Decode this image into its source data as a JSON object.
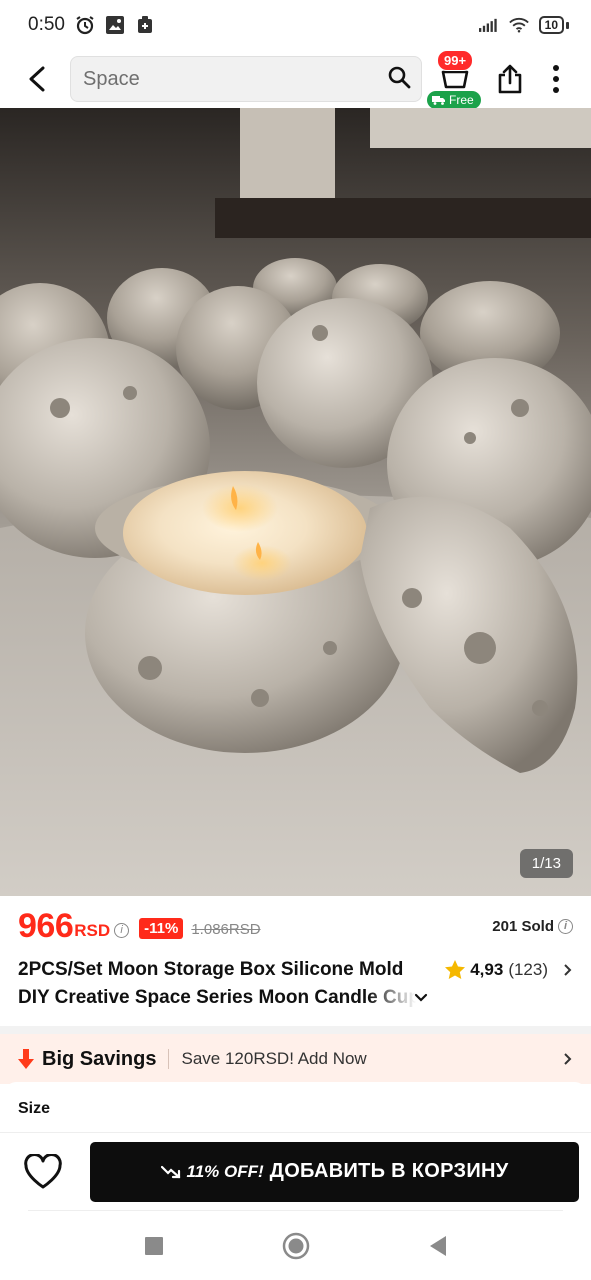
{
  "status_bar": {
    "time": "0:50",
    "battery": "10"
  },
  "search": {
    "placeholder": "Space"
  },
  "cart": {
    "badge": "99+",
    "free_label": "Free"
  },
  "gallery": {
    "counter": "1/13"
  },
  "price": {
    "amount": "966",
    "currency": "RSD",
    "discount": "-11%",
    "original": "1.086RSD",
    "sold": "201 Sold"
  },
  "product": {
    "title_line1": "2PCS/Set Moon Storage Box Silicone Mold",
    "title_line2": "DIY Creative Space Series Moon Candle Cup",
    "rating": "4,93",
    "rating_count": "(123)"
  },
  "savings": {
    "title": "Big Savings",
    "text": "Save 120RSD! Add Now"
  },
  "size": {
    "label": "Size"
  },
  "action": {
    "discount": "11% OFF!",
    "add_to_cart": "ДОБАВИТЬ В КОРЗИНУ"
  },
  "colors": {
    "price_red": "#ff2a1a",
    "free_green": "#1ba24a",
    "button_black": "#0d0d0d",
    "star_yellow": "#f5b800"
  }
}
